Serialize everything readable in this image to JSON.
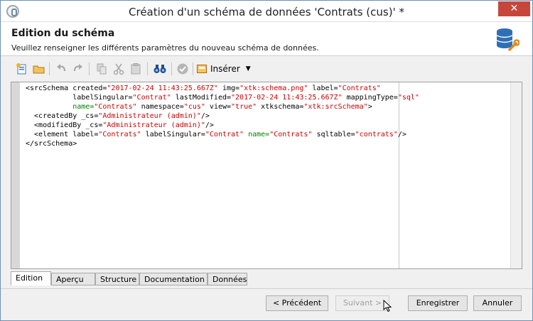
{
  "window": {
    "title": "Création d'un schéma de données 'Contrats (cus)' *",
    "close_label": "✕"
  },
  "header": {
    "title": "Edition du schéma",
    "subtitle": "Veuillez renseigner les différents paramètres du nouveau schéma de données."
  },
  "toolbar": {
    "buttons": [
      {
        "name": "new-icon"
      },
      {
        "name": "open-folder-icon"
      },
      {
        "name": "undo-icon"
      },
      {
        "name": "redo-icon"
      },
      {
        "name": "copy-icon"
      },
      {
        "name": "cut-icon"
      },
      {
        "name": "paste-icon"
      },
      {
        "name": "find-binoculars-icon"
      },
      {
        "name": "validate-icon"
      }
    ],
    "insert_label": "Insérer"
  },
  "code": {
    "l1_a": "<srcSchema ",
    "l1_created_attr": "created=",
    "l1_created_val": "\"2017-02-24 11:43:25.667Z\"",
    "l1_img_attr": " img=",
    "l1_img_val": "\"xtk:schema.png\"",
    "l1_label_attr": " label=",
    "l1_label_val": "\"Contrats\"",
    "l2_indent": "           ",
    "l2_ls_attr": "labelSingular=",
    "l2_ls_val": "\"Contrat\"",
    "l2_lm_attr": " lastModified=",
    "l2_lm_val": "\"2017-02-24 11:43:25.667Z\"",
    "l2_mt_attr": " mappingType=",
    "l2_mt_val": "\"sql\"",
    "l3_indent": "           ",
    "l3_name_attr": "name=",
    "l3_name_val": "\"Contrats\"",
    "l3_ns_attr": " namespace=",
    "l3_ns_val": "\"cus\"",
    "l3_view_attr": " view=",
    "l3_view_val": "\"true\"",
    "l3_xs_attr": " xtkschema=",
    "l3_xs_val": "\"xtk:srcSchema\"",
    "l3_end": ">",
    "l4_a": "  <createdBy _cs=",
    "l4_val": "\"Administrateur (admin)\"",
    "l4_end": "/>",
    "l5_a": "  <modifiedBy _cs=",
    "l5_val": "\"Administrateur (admin)\"",
    "l5_end": "/>",
    "l6_a": "  <element label=",
    "l6_label_val": "\"Contrats\"",
    "l6_ls_attr": " labelSingular=",
    "l6_ls_val": "\"Contrat\"",
    "l6_name_attr": " name=",
    "l6_name_val": "\"Contrats\"",
    "l6_sql_attr": " sqltable=",
    "l6_sql_val": "\"contrats\"",
    "l6_end": "/>",
    "l7": "</srcSchema>"
  },
  "tabs": [
    "Edition",
    "Aperçu",
    "Structure",
    "Documentation",
    "Données"
  ],
  "buttons": {
    "previous": "< Précédent",
    "next": "Suivant >",
    "save": "Enregistrer",
    "cancel": "Annuler"
  },
  "colors": {
    "close": "#c7463c",
    "string_value": "#cc0000",
    "green_attr": "#008000"
  }
}
